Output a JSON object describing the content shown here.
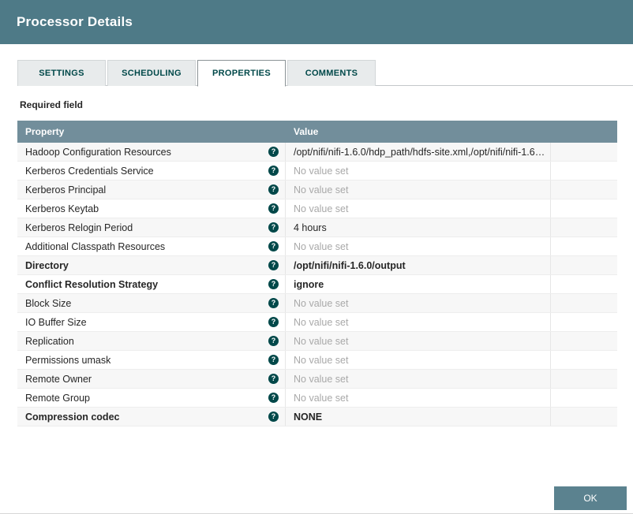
{
  "dialog": {
    "title": "Processor Details",
    "required_label": "Required field",
    "ok_label": "OK"
  },
  "tabs": [
    {
      "label": "SETTINGS",
      "active": false
    },
    {
      "label": "SCHEDULING",
      "active": false
    },
    {
      "label": "PROPERTIES",
      "active": true
    },
    {
      "label": "COMMENTS",
      "active": false
    }
  ],
  "icons": {
    "help_glyph": "?"
  },
  "table": {
    "columns": [
      "Property",
      "Value"
    ],
    "rows": [
      {
        "property": "Hadoop Configuration Resources",
        "value": "/opt/nifi/nifi-1.6.0/hdp_path/hdfs-site.xml,/opt/nifi/nifi-1.6.0...",
        "bold": false,
        "empty": false
      },
      {
        "property": "Kerberos Credentials Service",
        "value": "No value set",
        "bold": false,
        "empty": true
      },
      {
        "property": "Kerberos Principal",
        "value": "No value set",
        "bold": false,
        "empty": true
      },
      {
        "property": "Kerberos Keytab",
        "value": "No value set",
        "bold": false,
        "empty": true
      },
      {
        "property": "Kerberos Relogin Period",
        "value": "4 hours",
        "bold": false,
        "empty": false
      },
      {
        "property": "Additional Classpath Resources",
        "value": "No value set",
        "bold": false,
        "empty": true
      },
      {
        "property": "Directory",
        "value": "/opt/nifi/nifi-1.6.0/output",
        "bold": true,
        "empty": false
      },
      {
        "property": "Conflict Resolution Strategy",
        "value": "ignore",
        "bold": true,
        "empty": false
      },
      {
        "property": "Block Size",
        "value": "No value set",
        "bold": false,
        "empty": true
      },
      {
        "property": "IO Buffer Size",
        "value": "No value set",
        "bold": false,
        "empty": true
      },
      {
        "property": "Replication",
        "value": "No value set",
        "bold": false,
        "empty": true
      },
      {
        "property": "Permissions umask",
        "value": "No value set",
        "bold": false,
        "empty": true
      },
      {
        "property": "Remote Owner",
        "value": "No value set",
        "bold": false,
        "empty": true
      },
      {
        "property": "Remote Group",
        "value": "No value set",
        "bold": false,
        "empty": true
      },
      {
        "property": "Compression codec",
        "value": "NONE",
        "bold": true,
        "empty": false
      }
    ]
  },
  "colors": {
    "header-bg": "#4e7a87",
    "table-header-bg": "#728e9b",
    "tab-bg": "#e8ebec",
    "tab-text": "#004849",
    "help-icon-bg": "#004849",
    "ok-button-bg": "#5b828f",
    "unset-text": "#a9a9a9",
    "row-border": "#ededed"
  }
}
